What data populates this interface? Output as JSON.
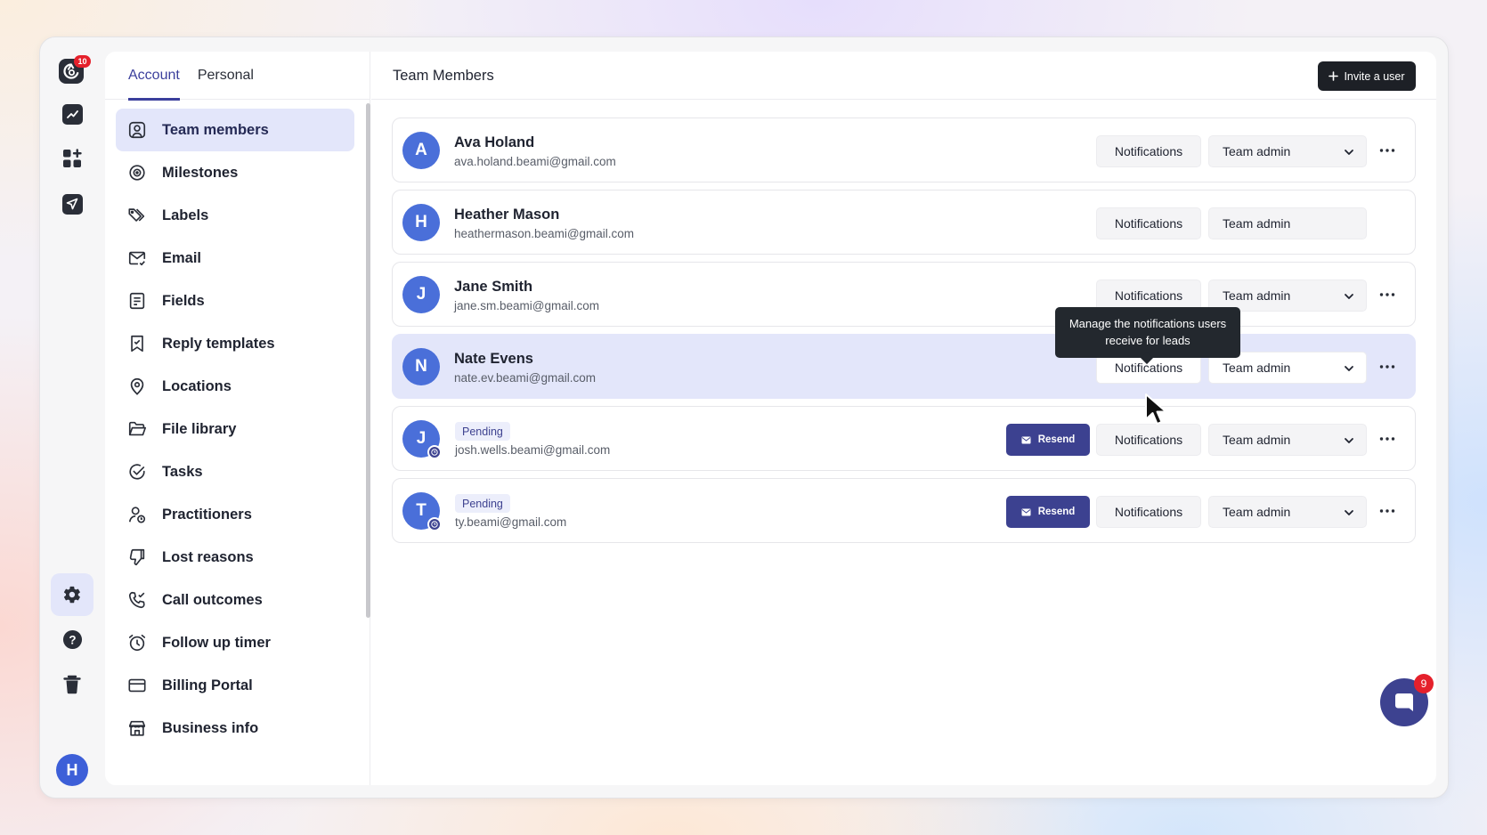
{
  "app": {
    "logo_badge": "10",
    "chat_badge": "9",
    "user_initial": "H"
  },
  "rail": {
    "icons": [
      "analytics-icon",
      "apps-icon",
      "send-icon",
      "settings-icon",
      "help-icon",
      "trash-icon"
    ]
  },
  "settings_nav": {
    "tabs": [
      {
        "label": "Account",
        "active": true
      },
      {
        "label": "Personal",
        "active": false
      }
    ],
    "items": [
      {
        "label": "Team members",
        "icon": "user-square-icon",
        "active": true
      },
      {
        "label": "Milestones",
        "icon": "target-icon"
      },
      {
        "label": "Labels",
        "icon": "tags-icon"
      },
      {
        "label": "Email",
        "icon": "mail-icon"
      },
      {
        "label": "Fields",
        "icon": "form-icon"
      },
      {
        "label": "Reply templates",
        "icon": "bookmark-icon"
      },
      {
        "label": "Locations",
        "icon": "location-icon"
      },
      {
        "label": "File library",
        "icon": "folder-icon"
      },
      {
        "label": "Tasks",
        "icon": "check-circle-icon"
      },
      {
        "label": "Practitioners",
        "icon": "user-clock-icon"
      },
      {
        "label": "Lost reasons",
        "icon": "thumbs-down-icon"
      },
      {
        "label": "Call outcomes",
        "icon": "phone-check-icon"
      },
      {
        "label": "Follow up timer",
        "icon": "alarm-icon"
      },
      {
        "label": "Billing Portal",
        "icon": "credit-card-icon"
      },
      {
        "label": "Business info",
        "icon": "store-icon"
      }
    ]
  },
  "header": {
    "title": "Team Members",
    "invite_label": "Invite a user"
  },
  "members": [
    {
      "initial": "A",
      "name": "Ava Holand",
      "email": "ava.holand.beami@gmail.com",
      "notifications_label": "Notifications",
      "role": "Team admin",
      "pending": false
    },
    {
      "initial": "H",
      "name": "Heather Mason",
      "email": "heathermason.beami@gmail.com",
      "notifications_label": "Notifications",
      "role": "Team admin",
      "pending": false
    },
    {
      "initial": "J",
      "name": "Jane Smith",
      "email": "jane.sm.beami@gmail.com",
      "notifications_label": "Notifications",
      "role": "Team admin",
      "pending": false
    },
    {
      "initial": "N",
      "name": "Nate Evens",
      "email": "nate.ev.beami@gmail.com",
      "notifications_label": "Notifications",
      "role": "Team admin",
      "pending": false
    },
    {
      "initial": "J",
      "status": "Pending",
      "email": "josh.wells.beami@gmail.com",
      "resend_label": "Resend",
      "notifications_label": "Notifications",
      "role": "Team admin",
      "pending": true
    },
    {
      "initial": "T",
      "status": "Pending",
      "email": "ty.beami@gmail.com",
      "resend_label": "Resend",
      "notifications_label": "Notifications",
      "role": "Team admin",
      "pending": true
    }
  ],
  "tooltip": {
    "text": "Manage the notifications users receive for leads"
  },
  "colors": {
    "accent": "#3c4190",
    "avatar": "#4a6fd9",
    "active_bg": "#e3e6fa",
    "badge": "#e5202b"
  }
}
